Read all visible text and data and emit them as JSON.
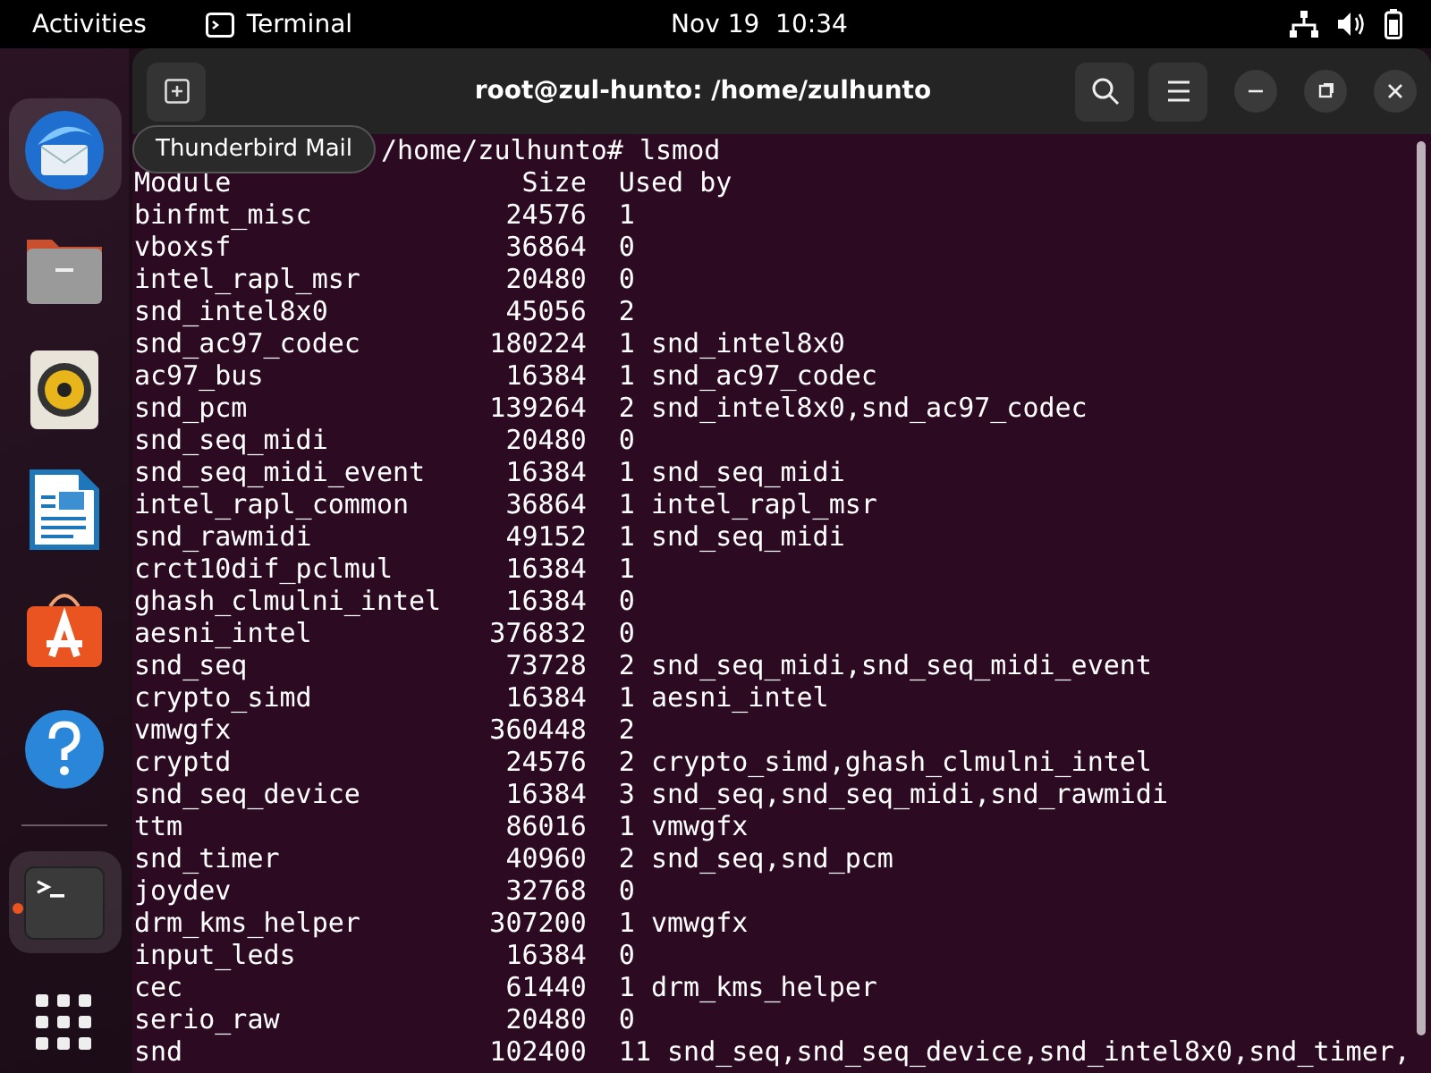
{
  "top_bar": {
    "activities": "Activities",
    "app_name": "Terminal",
    "clock": "Nov 19  10:34"
  },
  "dock": {
    "items": [
      {
        "kind": "mail",
        "highlighted": true,
        "running": false
      },
      {
        "kind": "files",
        "highlighted": false,
        "running": false
      },
      {
        "kind": "music",
        "highlighted": false,
        "running": false
      },
      {
        "kind": "writer",
        "highlighted": false,
        "running": false
      },
      {
        "kind": "store",
        "highlighted": false,
        "running": false
      },
      {
        "kind": "help",
        "highlighted": false,
        "running": false
      },
      {
        "kind": "separator"
      },
      {
        "kind": "terminal",
        "highlighted": true,
        "running": true
      },
      {
        "kind": "grid",
        "highlighted": false,
        "running": false
      }
    ],
    "tooltip": "Thunderbird Mail"
  },
  "window": {
    "title": "root@zul-hunto: /home/zulhunto"
  },
  "terminal": {
    "prompt": "/home/zulhunto# lsmod",
    "lines": [
      "Module                  Size  Used by",
      "binfmt_misc            24576  1",
      "vboxsf                 36864  0",
      "intel_rapl_msr         20480  0",
      "snd_intel8x0           45056  2",
      "snd_ac97_codec        180224  1 snd_intel8x0",
      "ac97_bus               16384  1 snd_ac97_codec",
      "snd_pcm               139264  2 snd_intel8x0,snd_ac97_codec",
      "snd_seq_midi           20480  0",
      "snd_seq_midi_event     16384  1 snd_seq_midi",
      "intel_rapl_common      36864  1 intel_rapl_msr",
      "snd_rawmidi            49152  1 snd_seq_midi",
      "crct10dif_pclmul       16384  1",
      "ghash_clmulni_intel    16384  0",
      "aesni_intel           376832  0",
      "snd_seq                73728  2 snd_seq_midi,snd_seq_midi_event",
      "crypto_simd            16384  1 aesni_intel",
      "vmwgfx                360448  2",
      "cryptd                 24576  2 crypto_simd,ghash_clmulni_intel",
      "snd_seq_device         16384  3 snd_seq,snd_seq_midi,snd_rawmidi",
      "ttm                    86016  1 vmwgfx",
      "snd_timer              40960  2 snd_seq,snd_pcm",
      "joydev                 32768  0",
      "drm_kms_helper        307200  1 vmwgfx",
      "input_leds             16384  0",
      "cec                    61440  1 drm_kms_helper",
      "serio_raw              20480  0",
      "snd                   102400  11 snd_seq,snd_seq_device,snd_intel8x0,snd_timer,"
    ]
  }
}
